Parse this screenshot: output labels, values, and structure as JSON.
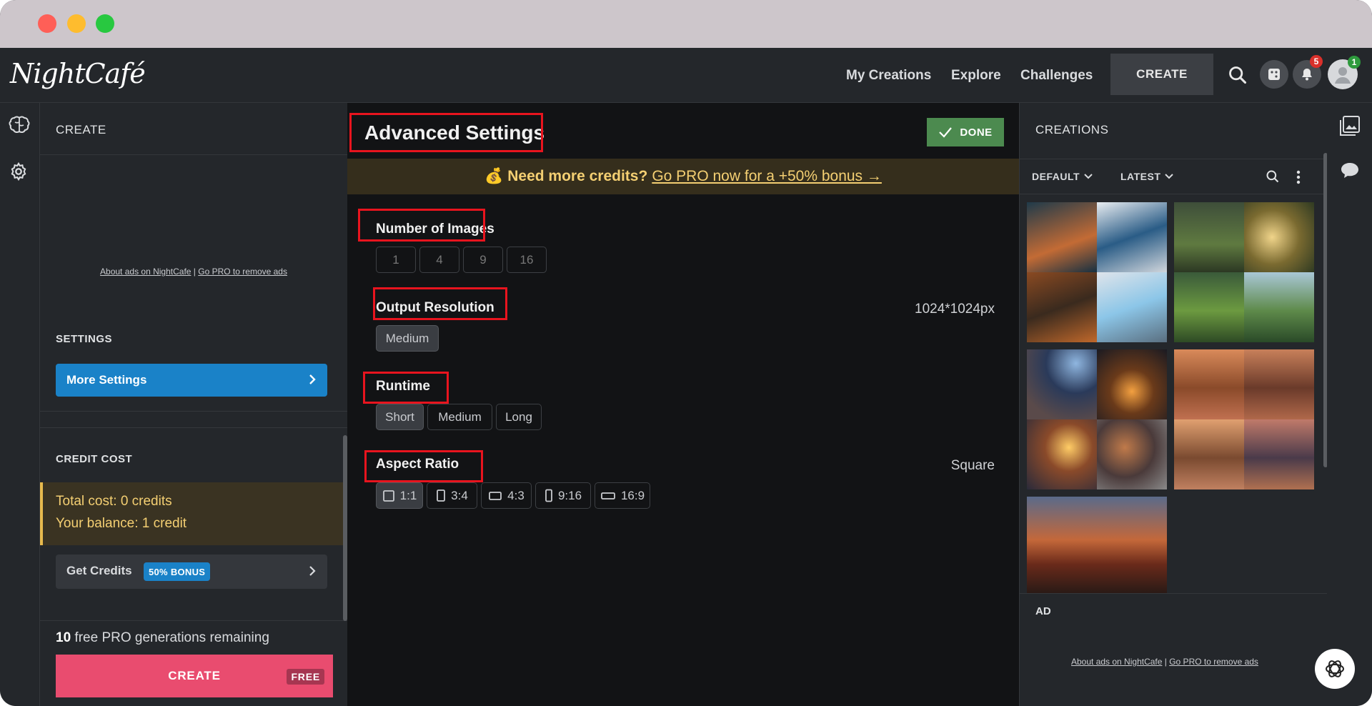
{
  "nav": {
    "logo": "NightCafé",
    "links": [
      "My Creations",
      "Explore",
      "Challenges"
    ],
    "create_label": "CREATE",
    "notifications_count": "5",
    "profile_count": "1"
  },
  "left": {
    "header": "CREATE",
    "ad_about": "About ads on NightCafe",
    "ad_sep": " | ",
    "ad_gopro": "Go PRO to remove ads",
    "settings_title": "SETTINGS",
    "more_settings": "More Settings",
    "credit_cost_title": "CREDIT COST",
    "total_cost": "Total cost: 0 credits",
    "balance": "Your balance: 1 credit",
    "get_credits": "Get Credits",
    "bonus": "50% BONUS",
    "free_count": "10",
    "free_text": " free PRO generations remaining",
    "create_label": "CREATE",
    "free_tag": "FREE"
  },
  "center": {
    "title": "Advanced Settings",
    "done": "DONE",
    "promo_emoji": "💰",
    "promo_bold": "Need more credits?",
    "promo_link": "Go PRO now for a +50% bonus →",
    "num_images": {
      "label": "Number of Images",
      "options": [
        "1",
        "4",
        "9",
        "16"
      ]
    },
    "resolution": {
      "label": "Output Resolution",
      "value": "1024*1024px",
      "options": [
        "Medium"
      ]
    },
    "runtime": {
      "label": "Runtime",
      "options": [
        "Short",
        "Medium",
        "Long"
      ]
    },
    "aspect": {
      "label": "Aspect Ratio",
      "value": "Square",
      "options": [
        "1:1",
        "3:4",
        "4:3",
        "9:16",
        "16:9"
      ]
    }
  },
  "right": {
    "header": "CREATIONS",
    "filter_default": "DEFAULT",
    "filter_latest": "LATEST",
    "ad_label": "AD",
    "ad_about": "About ads on NightCafe",
    "ad_sep": " | ",
    "ad_gopro": "Go PRO to remove ads"
  },
  "colors": {
    "accent_blue": "#1a82c8",
    "create_pink": "#e94c6f",
    "done_green": "#4c8a4f",
    "highlight_red": "#e8141e"
  }
}
